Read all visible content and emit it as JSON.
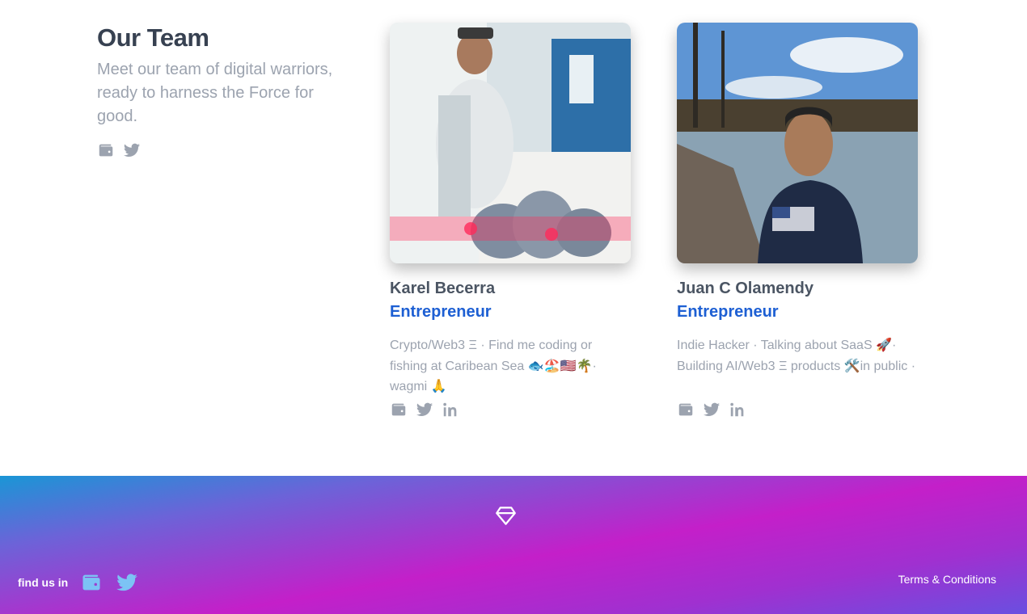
{
  "team": {
    "title": "Our Team",
    "subtitle": "Meet our team of digital warriors, ready to harness the Force for good.",
    "icons": [
      "wallet-icon",
      "twitter-icon"
    ]
  },
  "members": [
    {
      "name": "Karel Becerra",
      "role": "Entrepreneur",
      "bio": "Crypto/Web3 Ξ · Find me coding or fishing at Caribean Sea 🐟🏖️🇺🇸🌴· wagmi 🙏",
      "icons": [
        "wallet-icon",
        "twitter-icon",
        "linkedin-icon"
      ]
    },
    {
      "name": "Juan C Olamendy",
      "role": "Entrepreneur",
      "bio": "Indie Hacker · Talking about SaaS 🚀· Building AI/Web3 Ξ products 🛠️in public ·",
      "icons": [
        "wallet-icon",
        "twitter-icon",
        "linkedin-icon"
      ]
    }
  ],
  "footer": {
    "logo": "diamond-logo-icon",
    "find_us_label": "find us in",
    "icons": [
      "wallet-icon",
      "twitter-icon"
    ],
    "terms_label": "Terms & Conditions"
  },
  "colors": {
    "role_accent": "#1d5fd3",
    "muted_text": "#9ca3af",
    "footer_gradient": [
      "#1a96d6",
      "#c41fc9",
      "#6a4fe0"
    ]
  }
}
